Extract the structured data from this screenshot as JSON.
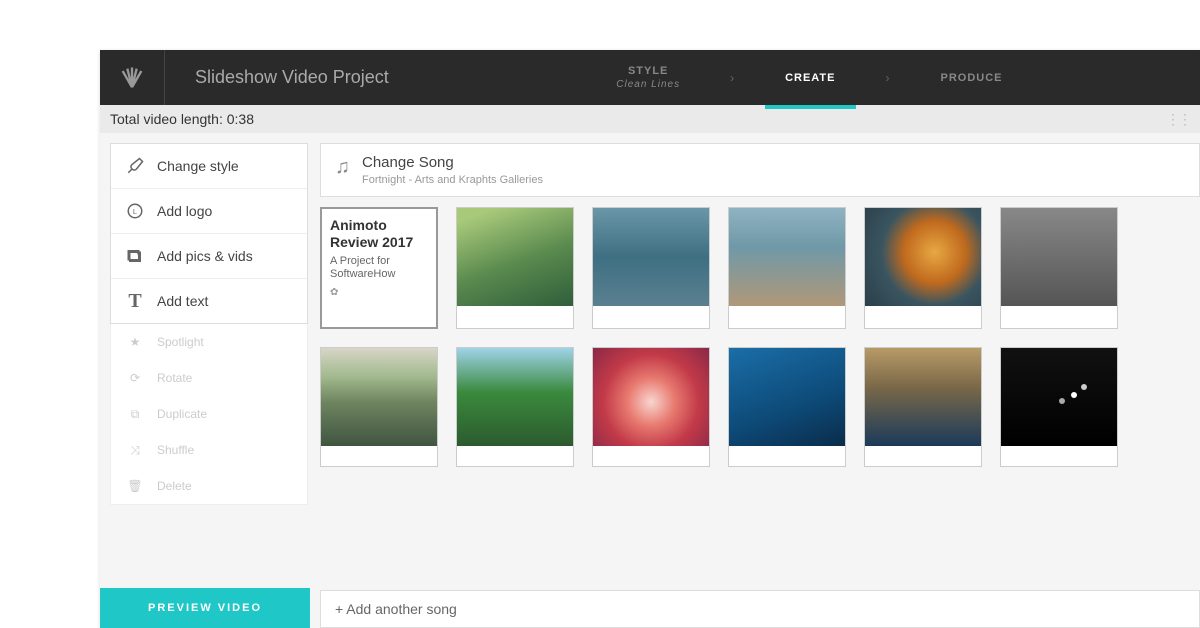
{
  "header": {
    "title": "Slideshow Video Project",
    "steps": [
      {
        "label": "STYLE",
        "sub": "Clean Lines",
        "active": false
      },
      {
        "label": "CREATE",
        "sub": "",
        "active": true
      },
      {
        "label": "PRODUCE",
        "sub": "",
        "active": false
      }
    ]
  },
  "length_bar": {
    "label": "Total video length: 0:38"
  },
  "sidebar": {
    "tools": [
      {
        "icon": "brush-icon",
        "label": "Change style"
      },
      {
        "icon": "logo-circle-icon",
        "label": "Add logo"
      },
      {
        "icon": "pics-icon",
        "label": "Add pics & vids"
      },
      {
        "icon": "text-icon",
        "label": "Add text"
      }
    ],
    "disabled_tools": [
      {
        "icon": "star-icon",
        "label": "Spotlight"
      },
      {
        "icon": "rotate-icon",
        "label": "Rotate"
      },
      {
        "icon": "duplicate-icon",
        "label": "Duplicate"
      },
      {
        "icon": "shuffle-icon",
        "label": "Shuffle"
      },
      {
        "icon": "trash-icon",
        "label": "Delete"
      }
    ],
    "preview_button": "PREVIEW VIDEO"
  },
  "song": {
    "title": "Change Song",
    "subtitle": "Fortnight - Arts and Kraphts Galleries"
  },
  "text_slide": {
    "title": "Animoto Review 2017",
    "subtitle": "A Project for SoftwareHow"
  },
  "add_song": {
    "label": "+ Add another song"
  }
}
